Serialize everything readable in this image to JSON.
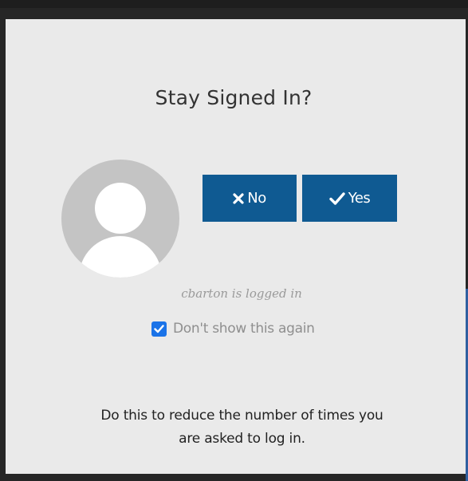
{
  "dialog": {
    "title": "Stay Signed In?",
    "buttons": {
      "no_label": "No",
      "no_icon": "close-x-icon",
      "yes_label": "Yes",
      "yes_icon": "checkmark-icon",
      "color": "#0f5a92"
    },
    "avatar_icon": "user-avatar-placeholder-icon",
    "status_text": "cbarton is logged in",
    "dont_show_again": {
      "label": "Don't show this again",
      "checked": true
    },
    "help_text_line1": "Do this to reduce the number of times you",
    "help_text_line2": "are asked to log in."
  }
}
